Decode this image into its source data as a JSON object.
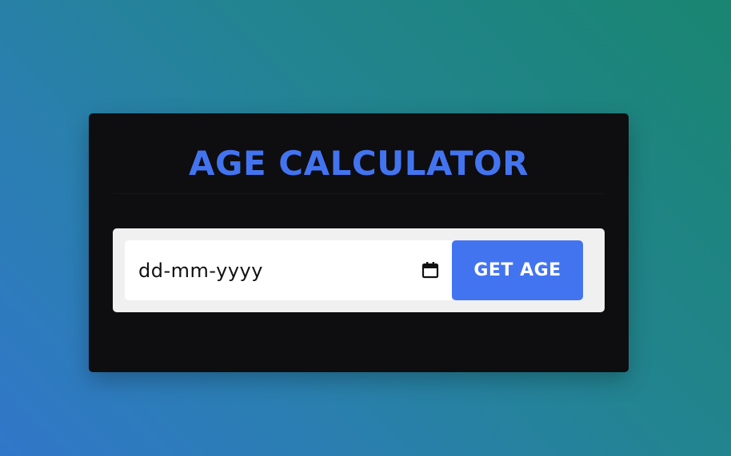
{
  "app": {
    "title": "AGE CALCULATOR"
  },
  "form": {
    "date_input": {
      "placeholder": "dd-mm-yyyy",
      "icon": "calendar-icon"
    },
    "submit_label": "GET AGE"
  },
  "colors": {
    "accent": "#4374f0",
    "card_background": "#0e0d0f",
    "panel_background": "#f0f0f0",
    "gradient_start": "#3177c9",
    "gradient_end": "#1a8571"
  }
}
